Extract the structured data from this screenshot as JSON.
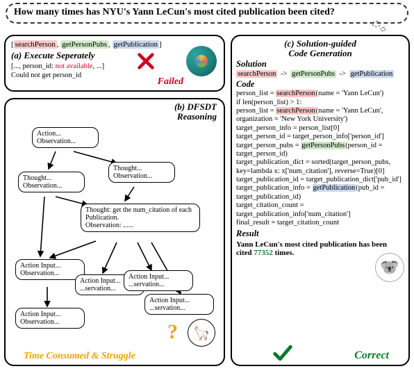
{
  "question": "How many times has NYU's Yann LeCun's most cited publication been cited?",
  "tags": {
    "t1": "searchPerson",
    "t2": "getPersonPubs",
    "t3": "getPublication"
  },
  "panelA": {
    "title": "(a) Execute Seperately",
    "line_prefix": "[..., person_id: ",
    "line_mid": "not available",
    "line_suffix": ", ...]",
    "line2": "Could not get person_id",
    "fail": "Failed"
  },
  "panelB": {
    "title1": "(b) DFSDT",
    "title2": "Reasoning",
    "nodes": {
      "n1a": "Action...",
      "n1b": "Observation...",
      "n2a": "Thought...",
      "n2b": "Observation...",
      "n3a": "Thought...",
      "n3b": "Observation...",
      "mid_a": "Thought:",
      "mid_b": " get the num_citation of each Publication.",
      "mid_c": "Observation: ......",
      "ai": "Action Input...",
      "ob": "Observation...",
      "ai2": "Action Input...",
      "ob2": "...servation...",
      "ai3": "Action Input...",
      "ob3": "...servation..."
    },
    "time": "Time Consumed & Struggle",
    "q": "?",
    "llama": "🦙"
  },
  "panelC": {
    "title1": "(c) Solution-guided",
    "title2": "Code Generation",
    "sec1": "Solution",
    "sec2": "Code",
    "sec3": "Result",
    "code": {
      "l1a": "person_list = ",
      "l1b": "searchPerson",
      "l1c": "(name = 'Yann LeCun')",
      "l2": "if len(person_list) > 1:",
      "l3a": "person_list = ",
      "l3b": "searchPerson",
      "l3c": "(name = 'Yann LeCun', organization = 'New York University')",
      "l4": "target_person_info = person_list[0]",
      "l5": "target_person_id = target_person_info['person_id']",
      "l6a": "target_person_pubs = ",
      "l6b": "getPersonPubs",
      "l6c": "(person_id = target_person_id)",
      "l7": "target_publication_dict = sorted(target_person_pubs, key=lambda x: x['num_citation'], reverse=True)[0]",
      "l8": "target_publication_id = target_publication_dict['pub_id']",
      "l9a": "target_publication_info = ",
      "l9b": "getPublication",
      "l9c": "(pub_id = target_publication_id)",
      "l10": "target_citation_count = target_publication_info['num_citation']",
      "l11": "final_result = target_citation_count"
    },
    "result_pre": "Yann LeCun's most cited publication has been cited ",
    "result_num": "77352",
    "result_post": " times.",
    "correct": "Correct",
    "koala": "🐨"
  }
}
